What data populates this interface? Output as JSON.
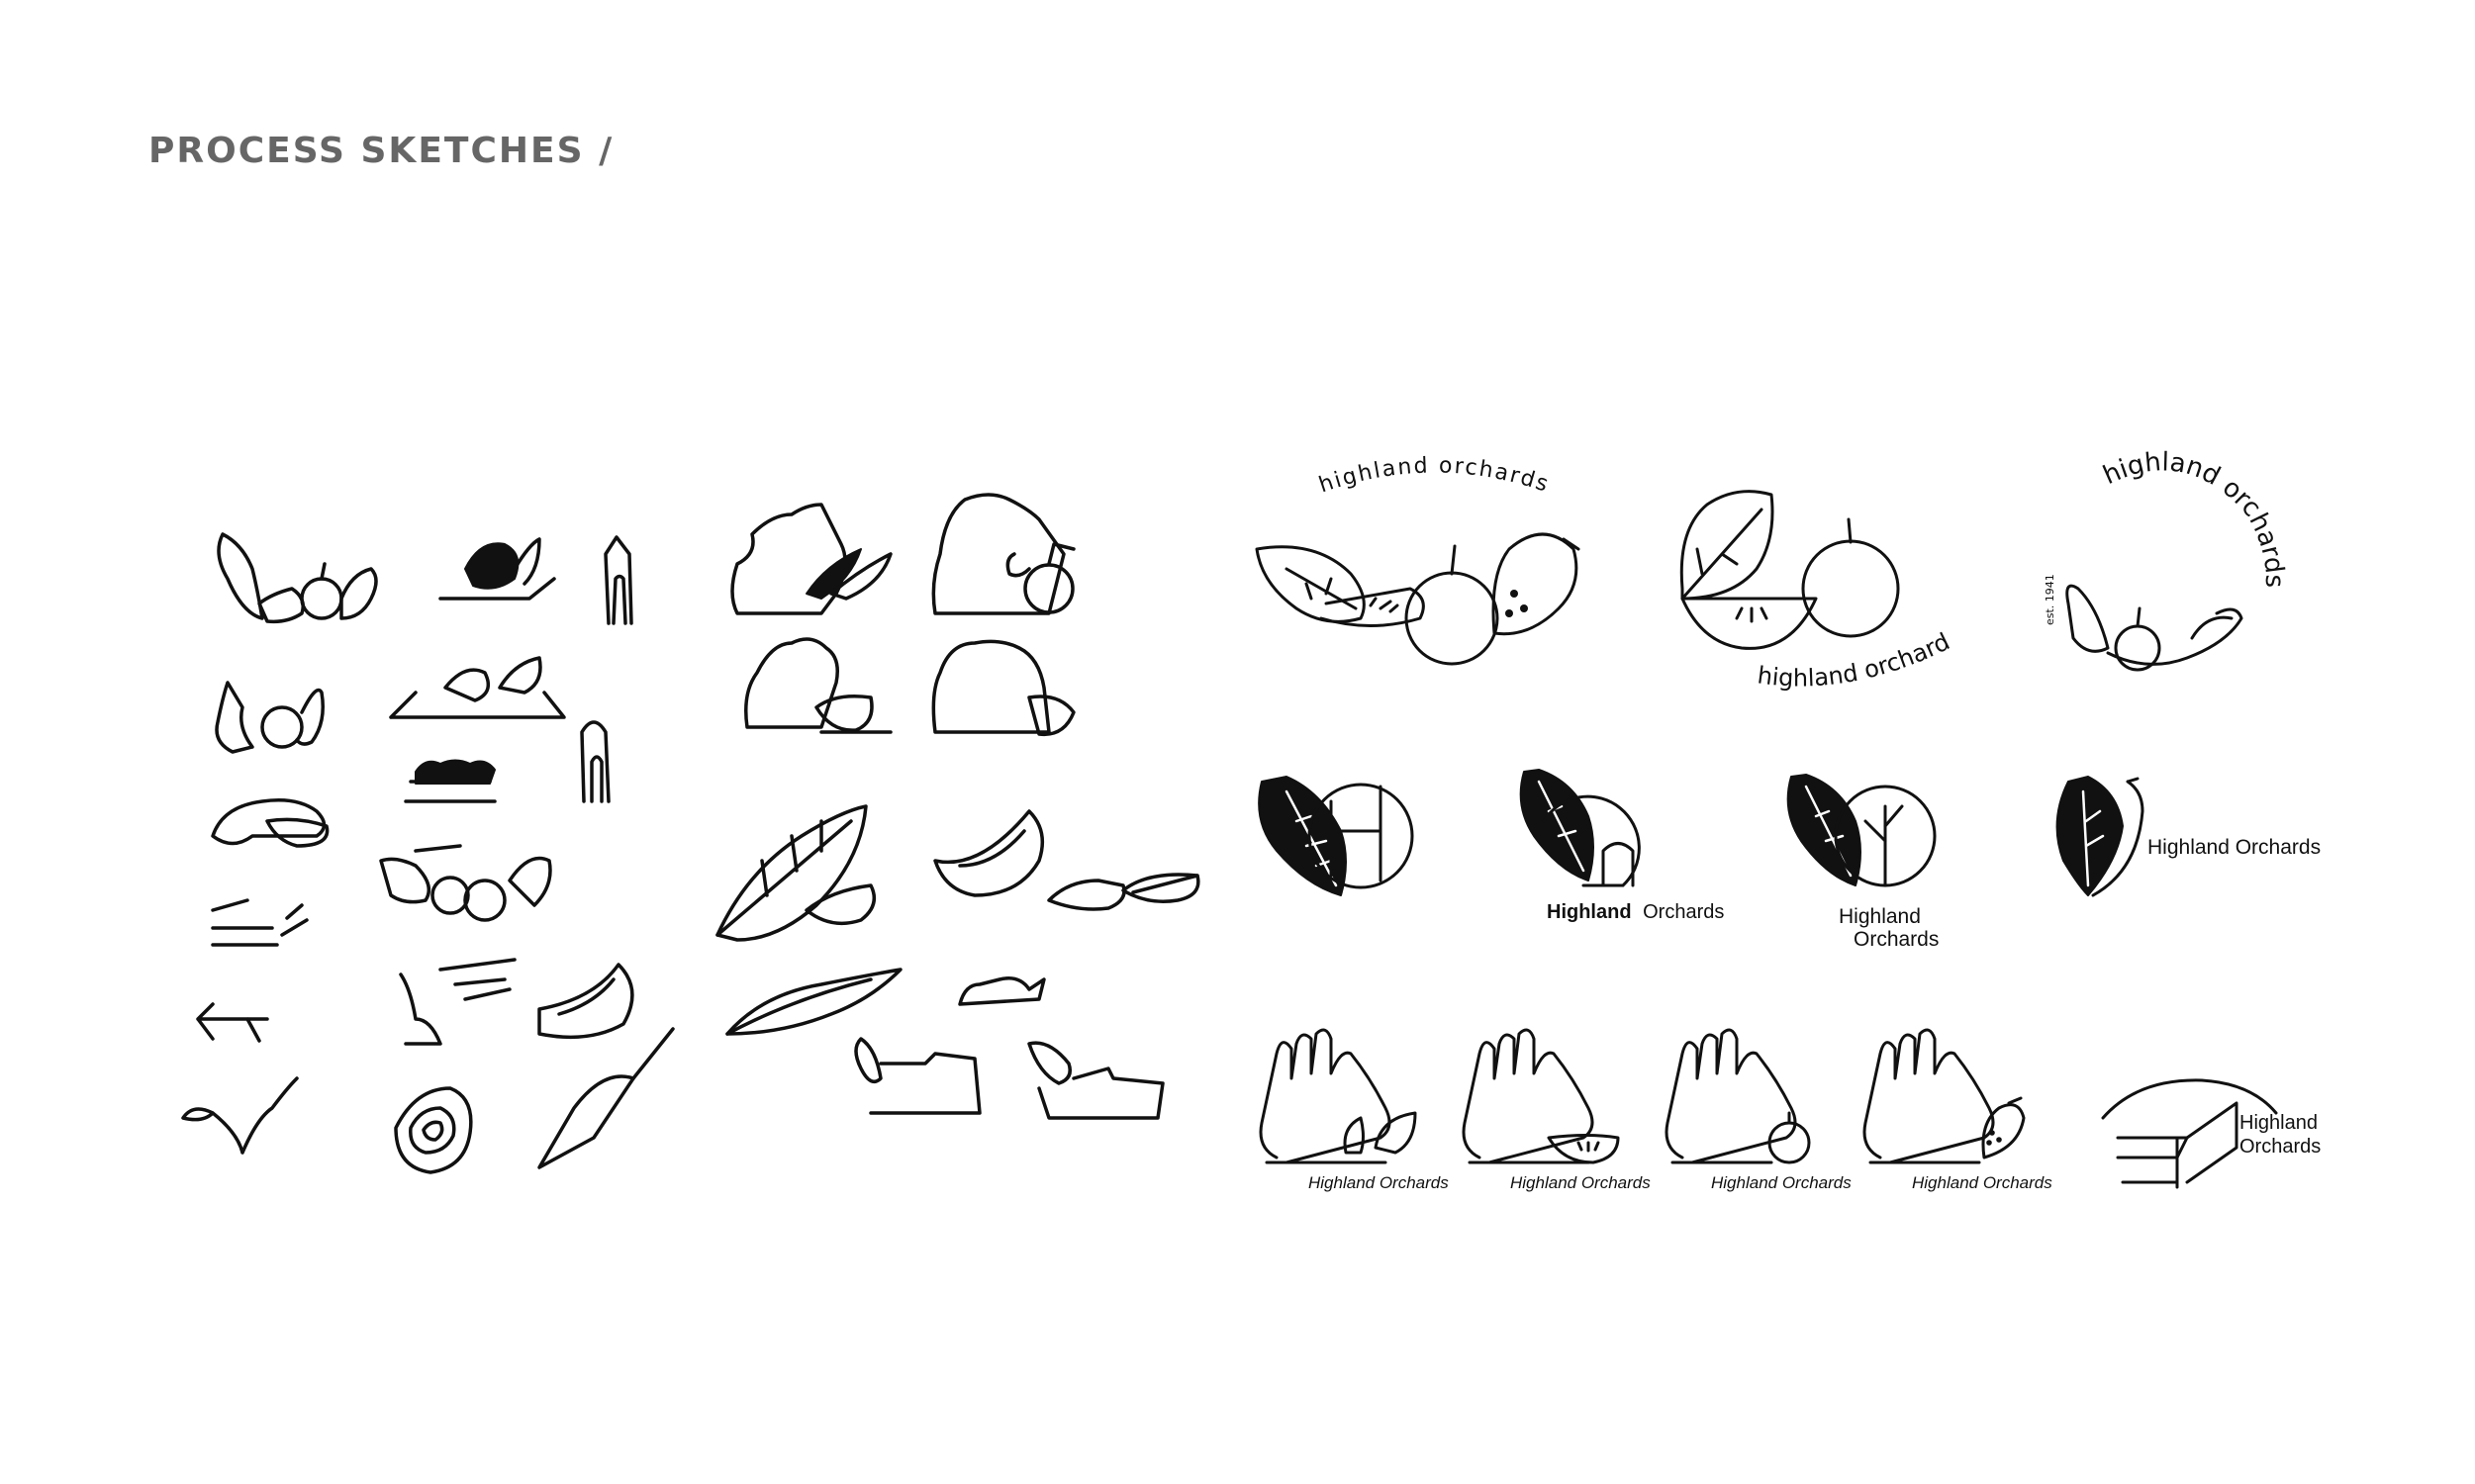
{
  "header": {
    "title": "PROCESS SKETCHES /"
  },
  "logos": {
    "arc_wordmark": "highland orchards",
    "wordmark_lower": "highland orchards",
    "circle_wordmark": "highland orchards",
    "established": "est. 1941",
    "brand_bold": "Highland",
    "brand_regular": "Orchards",
    "brand_line1": "Highland",
    "brand_line2": "Orchards",
    "brand_full": "Highland Orchards",
    "hand_captions": [
      "Highland Orchards",
      "Highland Orchards",
      "Highland Orchards",
      "Highland Orchards"
    ]
  }
}
